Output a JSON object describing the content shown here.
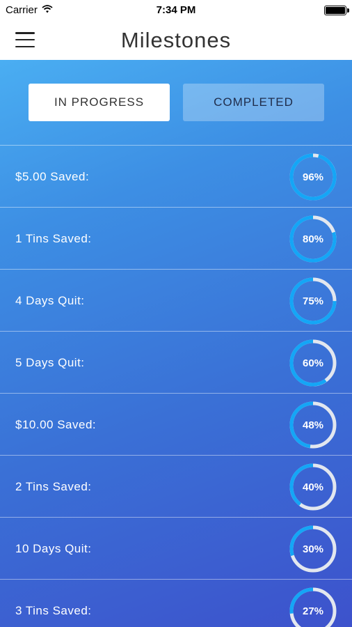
{
  "status": {
    "carrier": "Carrier",
    "time": "7:34 PM"
  },
  "nav": {
    "title": "Milestones"
  },
  "tabs": {
    "in_progress": "IN PROGRESS",
    "completed": "COMPLETED"
  },
  "colors": {
    "ring_track": "#e2e7ef",
    "ring_progress": "#14a6f6"
  },
  "milestones": [
    {
      "label": "$5.00 Saved:",
      "percent": 96,
      "percent_text": "96%"
    },
    {
      "label": "1 Tins Saved:",
      "percent": 80,
      "percent_text": "80%"
    },
    {
      "label": "4 Days Quit:",
      "percent": 75,
      "percent_text": "75%"
    },
    {
      "label": "5 Days Quit:",
      "percent": 60,
      "percent_text": "60%"
    },
    {
      "label": "$10.00 Saved:",
      "percent": 48,
      "percent_text": "48%"
    },
    {
      "label": "2 Tins Saved:",
      "percent": 40,
      "percent_text": "40%"
    },
    {
      "label": "10 Days Quit:",
      "percent": 30,
      "percent_text": "30%"
    },
    {
      "label": "3 Tins Saved:",
      "percent": 27,
      "percent_text": "27%"
    }
  ]
}
